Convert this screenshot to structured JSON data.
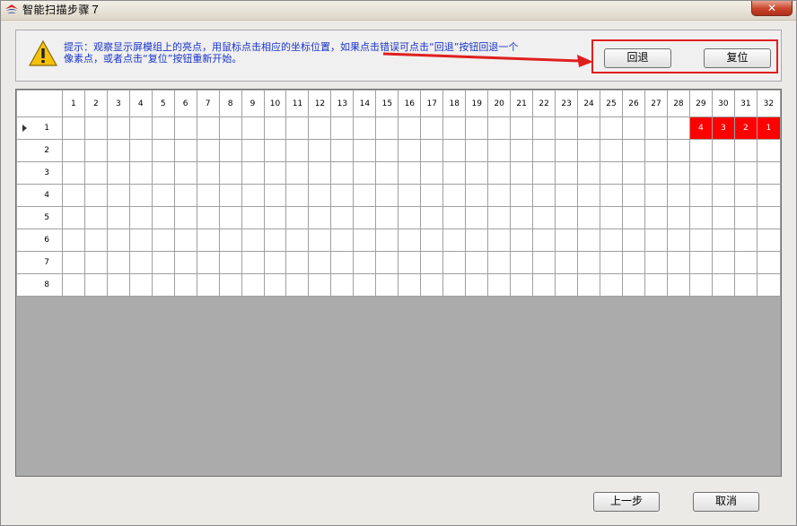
{
  "window": {
    "title": "智能扫描步骤７",
    "close_label": "✕"
  },
  "hint": {
    "text_line1": "提示：观察显示屏模组上的亮点，用鼠标点击相应的坐标位置，如果点击错误可点击“回退”按钮回退一个",
    "text_line2": "像素点，或者点击“复位”按钮重新开始。"
  },
  "buttons": {
    "back_step": "回退",
    "reset": "复位",
    "prev": "上一步",
    "cancel": "取消"
  },
  "grid": {
    "columns": [
      "1",
      "2",
      "3",
      "4",
      "5",
      "6",
      "7",
      "8",
      "9",
      "10",
      "11",
      "12",
      "13",
      "14",
      "15",
      "16",
      "17",
      "18",
      "19",
      "20",
      "21",
      "22",
      "23",
      "24",
      "25",
      "26",
      "27",
      "28",
      "29",
      "30",
      "31",
      "32"
    ],
    "rows": [
      "1",
      "2",
      "3",
      "4",
      "5",
      "6",
      "7",
      "8"
    ],
    "lit_cells": [
      {
        "row": 1,
        "col": 29,
        "label": "4"
      },
      {
        "row": 1,
        "col": 30,
        "label": "3"
      },
      {
        "row": 1,
        "col": 31,
        "label": "2"
      },
      {
        "row": 1,
        "col": 32,
        "label": "1"
      }
    ],
    "current_row": 1,
    "lit_color": "#ff0000"
  },
  "annotation": {
    "color": "#e01e1e"
  }
}
